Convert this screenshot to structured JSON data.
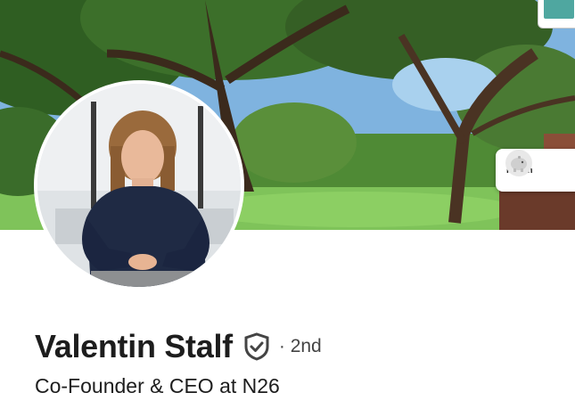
{
  "profile": {
    "name": "Valentin Stalf",
    "connection_prefix": "·",
    "connection_degree": "2nd",
    "headline": "Co-Founder & CEO at N26"
  },
  "cover": {
    "card_text": "Instan",
    "icons": [
      "piggy-bank-icon"
    ]
  },
  "icons": {
    "verified": "verified-shield-icon"
  },
  "colors": {
    "text_primary": "#1d1d1d",
    "text_secondary": "#444444"
  }
}
